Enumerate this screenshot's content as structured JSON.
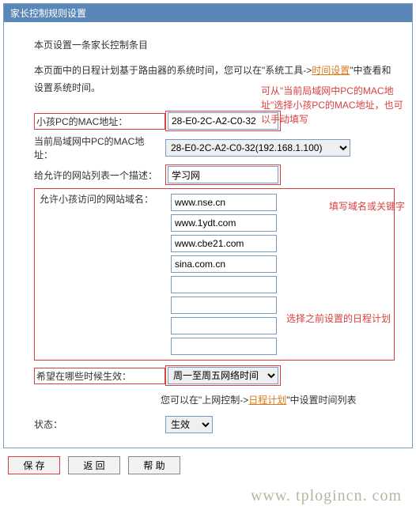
{
  "panel": {
    "title": "家长控制规则设置"
  },
  "intro": {
    "line1": "本页设置一条家长控制条目",
    "line2a": "本页面中的日程计划基于路由器的系统时间，您可以在\"系统工具->",
    "time_link": "时间设置",
    "line2b": "\"中查看和设置系统时间。"
  },
  "fields": {
    "child_mac_label": "小孩PC的MAC地址：",
    "child_mac_value": "28-E0-2C-A2-C0-32",
    "lan_mac_label": "当前局域网中PC的MAC地址：",
    "lan_mac_value": "28-E0-2C-A2-C0-32(192.168.1.100)",
    "desc_label": "给允许的网站列表一个描述：",
    "desc_value": "学习网",
    "domains_label": "允许小孩访问的网站域名：",
    "domains": [
      "www.nse.cn",
      "www.1ydt.com",
      "www.cbe21.com",
      "sina.com.cn",
      "",
      "",
      "",
      ""
    ],
    "schedule_label": "希望在哪些时候生效：",
    "schedule_value": "周一至周五网络时间",
    "hint_a": "您可以在\"上网控制->",
    "hint_link": "日程计划",
    "hint_b": "\"中设置时间列表",
    "status_label": "状态：",
    "status_value": "生效"
  },
  "annotations": {
    "top": "可从\"当前局域网中PC的MAC地址\"选择小孩PC的MAC地址，也可以手动填写",
    "mid": "填写域名或关键字",
    "bottom": "选择之前设置的日程计划"
  },
  "buttons": {
    "save": "保 存",
    "back": "返 回",
    "help": "帮 助"
  },
  "footer": {
    "text": "www. tplogincn. com"
  }
}
